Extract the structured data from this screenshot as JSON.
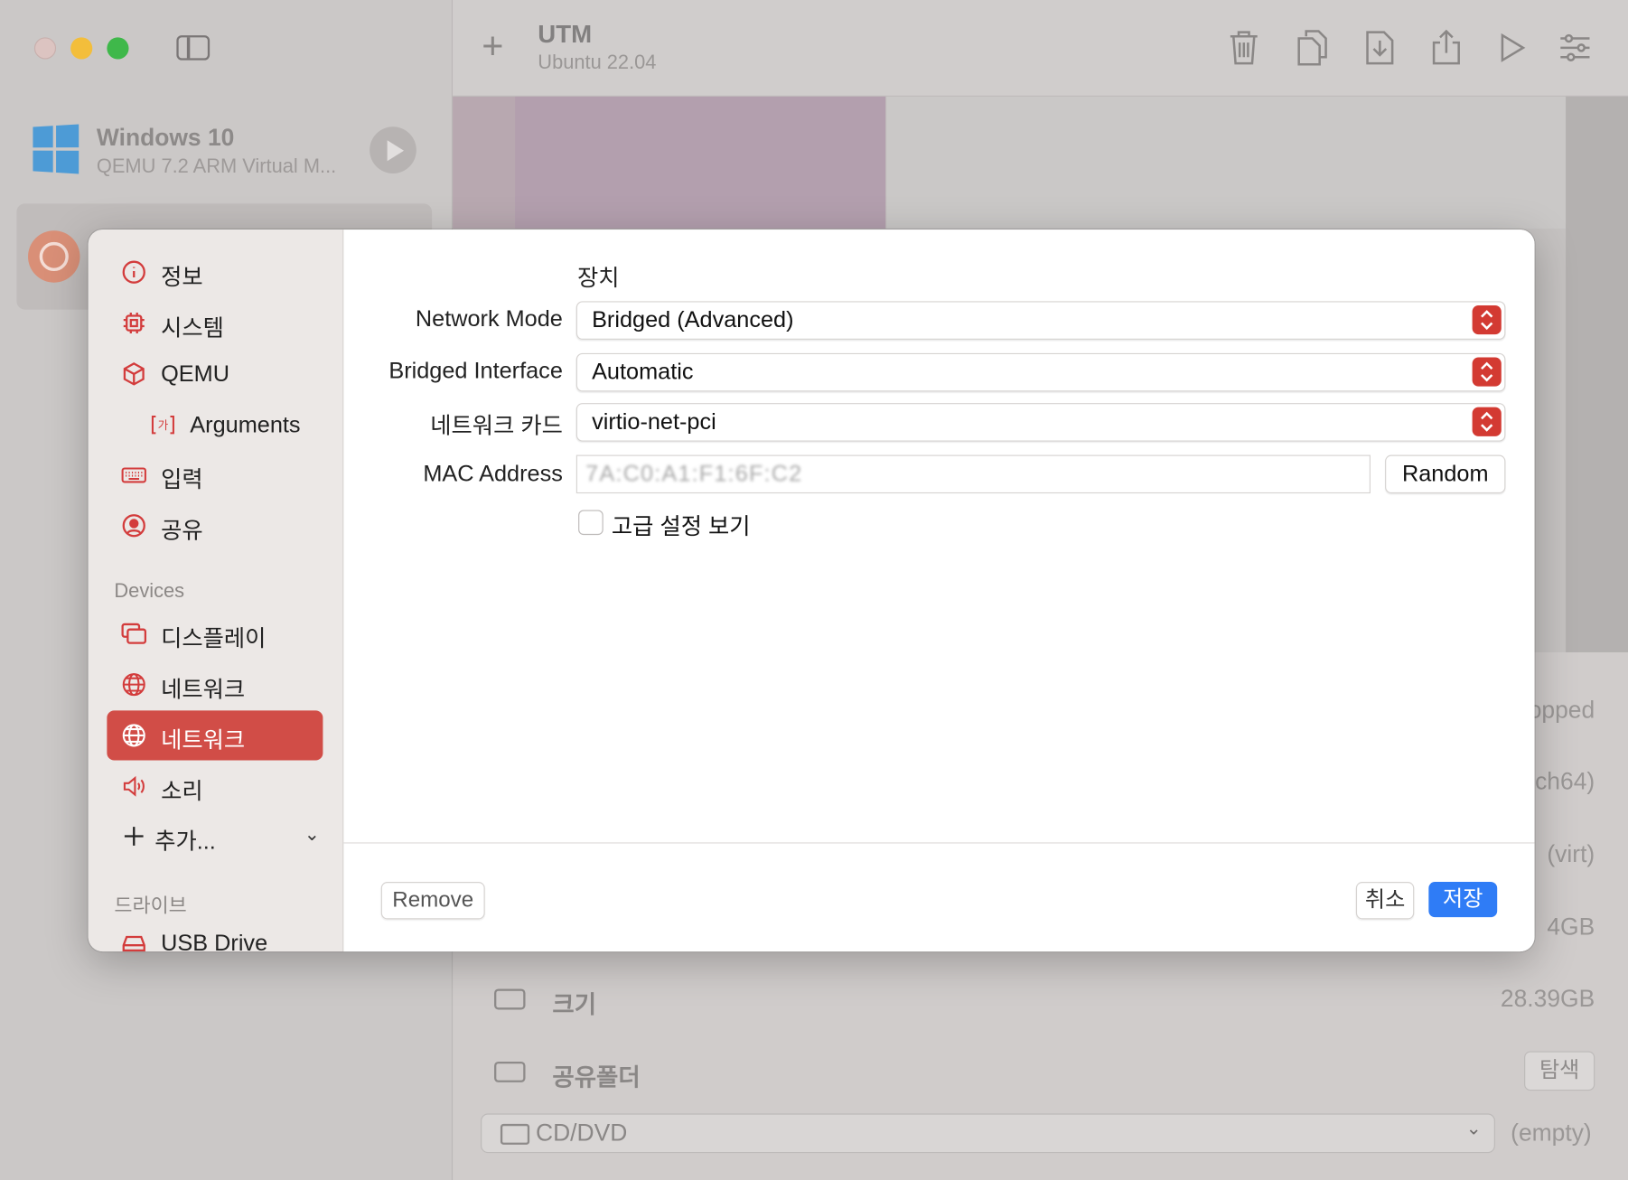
{
  "app": {
    "title": "UTM",
    "subtitle": "Ubuntu 22.04"
  },
  "vm_list": [
    {
      "name": "Windows 10",
      "subtitle": "QEMU 7.2 ARM Virtual M..."
    }
  ],
  "vm_details": {
    "rows": [
      {
        "label": "",
        "value": "opped"
      },
      {
        "label": "",
        "value": "ch64)"
      },
      {
        "label": "",
        "value": "(virt)"
      },
      {
        "label": "",
        "value": "4GB"
      },
      {
        "label": "크기",
        "value": "28.39GB"
      },
      {
        "label": "공유폴더",
        "value": ""
      }
    ],
    "shared_folder_button": "탐색",
    "cd_drive": {
      "label": "CD/DVD",
      "status": "(empty)"
    }
  },
  "dialog": {
    "sidebar": {
      "items": [
        {
          "label": "정보",
          "icon": "info-icon"
        },
        {
          "label": "시스템",
          "icon": "cpu-icon"
        },
        {
          "label": "QEMU",
          "icon": "cube-icon"
        },
        {
          "label": "Arguments",
          "icon": "arguments-icon"
        },
        {
          "label": "입력",
          "icon": "keyboard-icon"
        },
        {
          "label": "공유",
          "icon": "person-circle-icon"
        }
      ],
      "devices_header": "Devices",
      "devices": [
        {
          "label": "디스플레이",
          "icon": "display-icon"
        },
        {
          "label": "네트워크",
          "icon": "globe-icon"
        },
        {
          "label": "네트워크",
          "icon": "globe-icon",
          "selected": true
        },
        {
          "label": "소리",
          "icon": "speaker-icon"
        }
      ],
      "add_label": "추가...",
      "drives_header": "드라이브",
      "drives": [
        {
          "label": "USB Drive",
          "icon": "drive-icon"
        }
      ]
    },
    "form": {
      "section_title": "장치",
      "network_mode_label": "Network Mode",
      "network_mode_value": "Bridged (Advanced)",
      "bridged_interface_label": "Bridged Interface",
      "bridged_interface_value": "Automatic",
      "network_card_label": "네트워크 카드",
      "network_card_value": "virtio-net-pci",
      "mac_label": "MAC Address",
      "mac_value": "7A:C0:A1:F1:6F:C2",
      "random_label": "Random",
      "advanced_label": "고급 설정 보기",
      "advanced_checked": false
    },
    "footer": {
      "remove_label": "Remove",
      "cancel_label": "취소",
      "save_label": "저장"
    }
  },
  "colors": {
    "accent": "#D14D47",
    "save_button": "#2F7CF6",
    "stepper": "#D33A32"
  }
}
